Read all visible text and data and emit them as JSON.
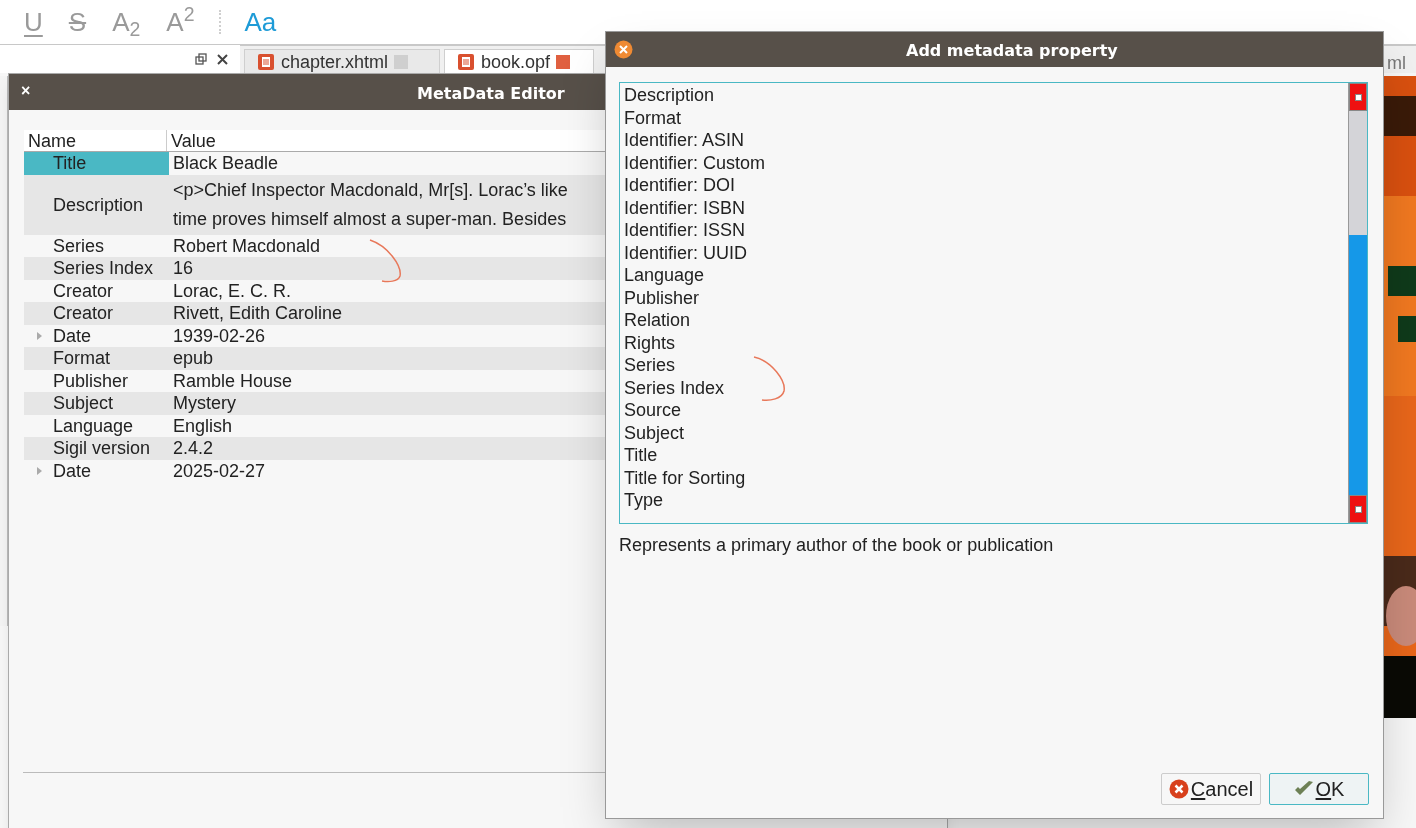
{
  "toolbar": [
    {
      "label": "U",
      "kind": "underline"
    },
    {
      "label": "S",
      "kind": "strike"
    },
    {
      "label": "A$_{2}$",
      "kind": "plain"
    },
    {
      "label": "A$^{2}$",
      "kind": "plain"
    },
    {
      "label": "Aa",
      "kind": "accent"
    }
  ],
  "tabs": [
    {
      "label": "chapter.xhtml",
      "selected": false
    },
    {
      "label": "book.opf",
      "selected": true
    }
  ],
  "hidden_tab_fragment": "ml",
  "metadata_editor": {
    "title": "MetaData Editor",
    "close": "×",
    "columns": [
      "Name",
      "Value"
    ],
    "rows": [
      {
        "name": "Title",
        "value": "Black Beadle",
        "selected": true
      },
      {
        "name": "Description",
        "value": "<p>Chief Inspector Macdonald, Mr[s]. Lorac’s like\ntime proves himself almost a super-man. Besides",
        "selected": false
      },
      {
        "name": "Series",
        "value": "Robert Macdonald",
        "selected": false
      },
      {
        "name": "Series Index",
        "value": "16",
        "selected": false
      },
      {
        "name": "Creator",
        "value": "Lorac, E. C. R.",
        "selected": false
      },
      {
        "name": "Creator",
        "value": "Rivett, Edith Caroline",
        "selected": false
      },
      {
        "name": "Date",
        "value": "1939-02-26",
        "selected": false,
        "expanded": false
      },
      {
        "name": "Format",
        "value": "epub",
        "selected": false
      },
      {
        "name": "Publisher",
        "value": "Ramble House",
        "selected": false
      },
      {
        "name": "Subject",
        "value": "Mystery",
        "selected": false
      },
      {
        "name": "Language",
        "value": "English",
        "selected": false
      },
      {
        "name": "Sigil version",
        "value": "2.4.2",
        "selected": false
      },
      {
        "name": "Date",
        "value": "2025-02-27",
        "selected": false,
        "expanded": false
      }
    ]
  },
  "dialog": {
    "title": "Add metadata property",
    "items": [
      "Description",
      "Format",
      "Identifier: ASIN",
      "Identifier: Custom",
      "Identifier: DOI",
      "Identifier: ISBN",
      "Identifier: ISSN",
      "Identifier: UUID",
      "Language",
      "Publisher",
      "Relation",
      "Rights",
      "Series",
      "Series Index",
      "Source",
      "Subject",
      "Title",
      "Title for Sorting",
      "Type"
    ],
    "description": "Represents a primary author of the book or publication",
    "buttons": [
      {
        "label": "Cancel",
        "kind": "cancel"
      },
      {
        "label": "OK",
        "kind": "ok"
      }
    ]
  }
}
